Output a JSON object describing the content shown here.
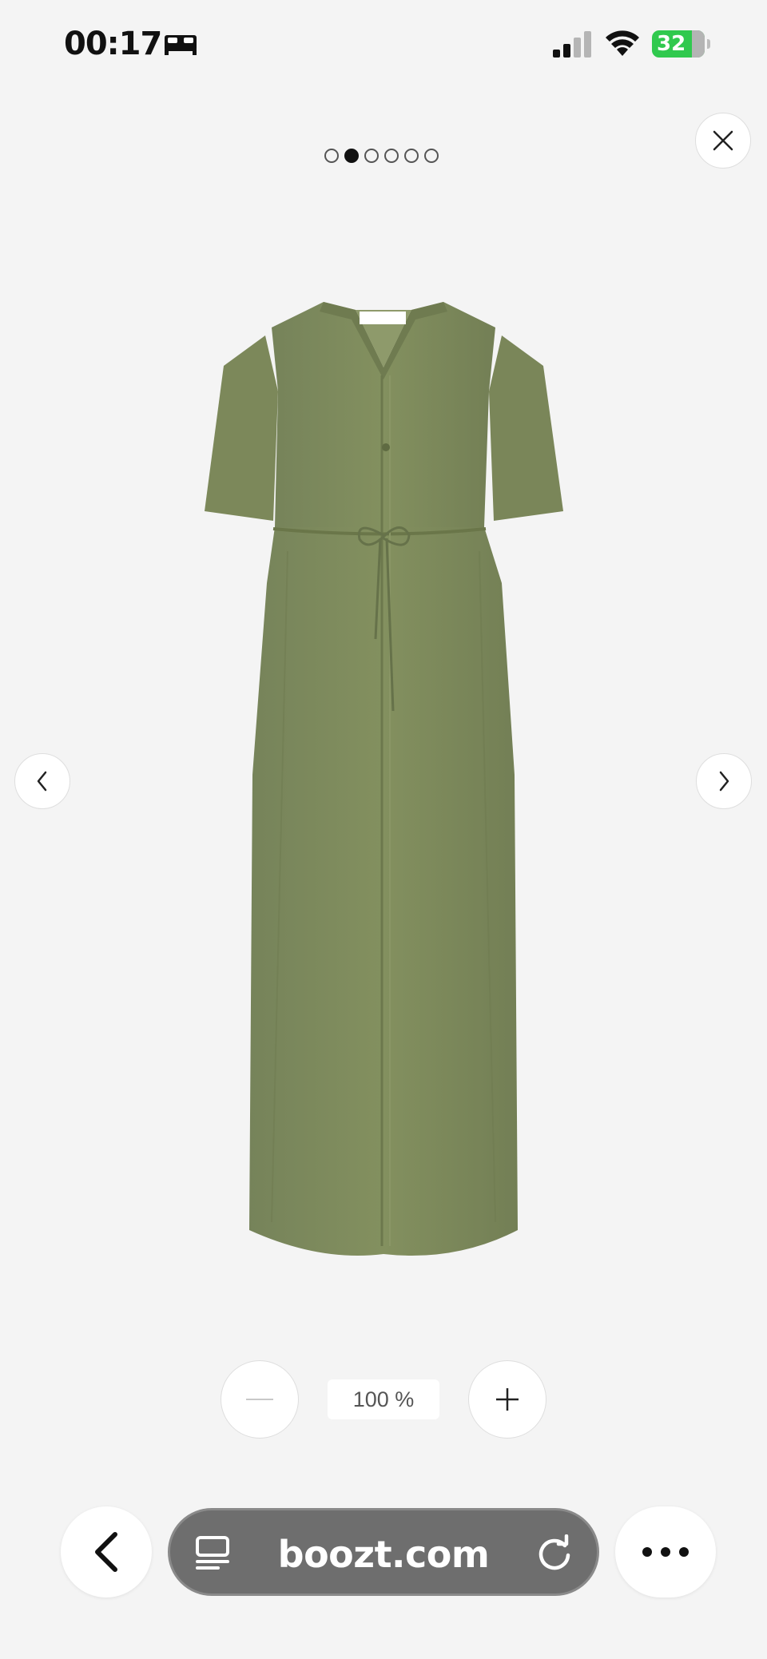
{
  "status_bar": {
    "time": "00:17",
    "battery_level": "32",
    "icons": [
      "sleep-icon",
      "signal-icon",
      "wifi-icon",
      "battery-icon"
    ]
  },
  "gallery": {
    "total_images": 6,
    "active_index": 1,
    "product_color": "#7e8a5c"
  },
  "zoom": {
    "value": "100 %"
  },
  "browser": {
    "url": "boozt.com"
  }
}
